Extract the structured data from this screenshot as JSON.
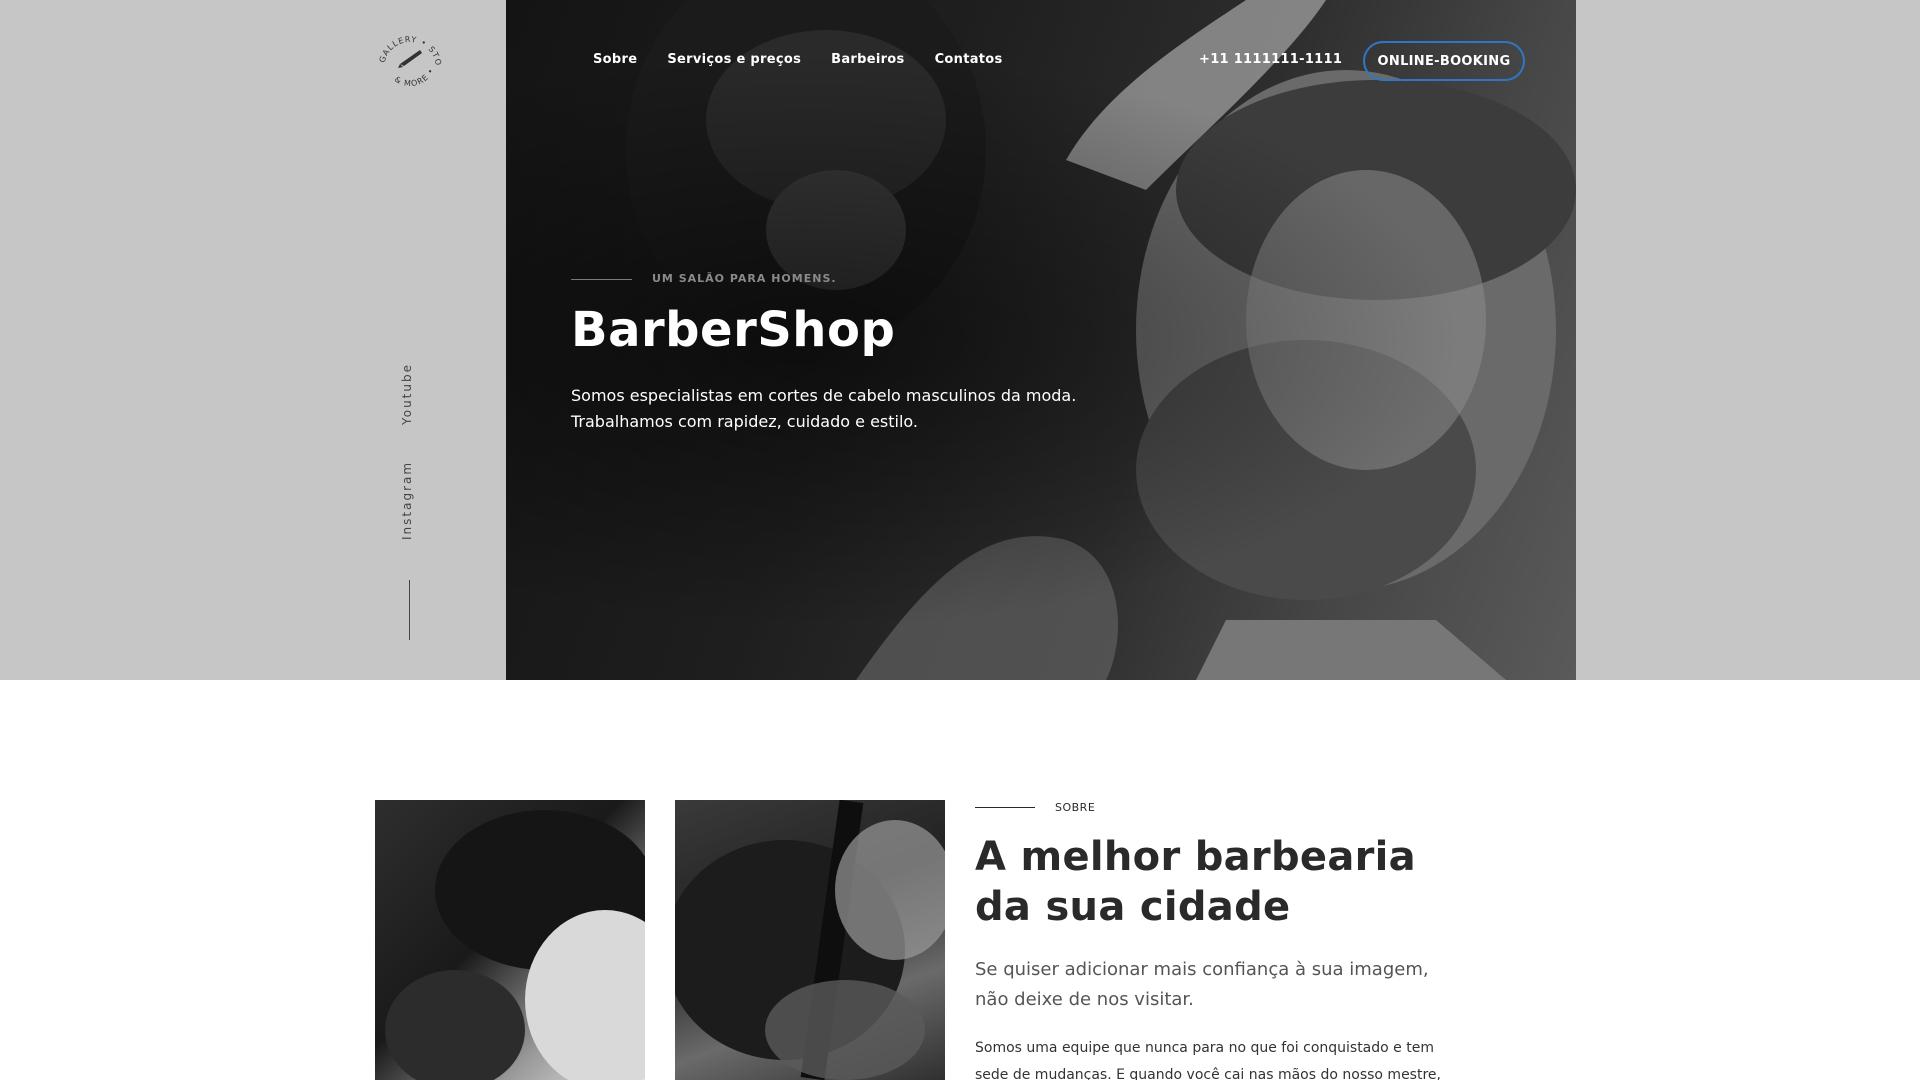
{
  "brand": {
    "logo_text_top": "GALLERY • STORE",
    "logo_text_bottom": "& MORE •"
  },
  "nav": {
    "items": [
      {
        "label": "Sobre"
      },
      {
        "label": "Serviços e preços"
      },
      {
        "label": "Barbeiros"
      },
      {
        "label": "Contatos"
      }
    ],
    "phone": "+11 1111111-1111",
    "booking_label": "ONLINE-BOOKING",
    "booking_border_color": "#2f77c6"
  },
  "hero": {
    "eyebrow": "UM SALÃO PARA HOMENS.",
    "title": "BarberShop",
    "description_line1": "Somos especialistas em cortes de cabelo masculinos da moda.",
    "description_line2": "Trabalhamos com rapidez, cuidado e estilo.",
    "photo_subject": "barber-trimming-beard-photo"
  },
  "social": {
    "youtube": "Youtube",
    "instagram": "Instagram"
  },
  "gallery": {
    "images": [
      {
        "subject": "beard-trim-photo"
      },
      {
        "subject": "haircut-razor-photo"
      }
    ]
  },
  "about": {
    "eyebrow": "SOBRE",
    "title_line1": "A melhor barbearia",
    "title_line2": "da sua cidade",
    "subtitle_line1": "Se quiser adicionar mais confiança à sua imagem,",
    "subtitle_line2": "não deixe de nos visitar.",
    "body_line1": "Somos uma equipe que nunca para no que foi conquistado e tem",
    "body_line2": "sede de mudanças. E quando você cai nas mãos do nosso mestre,"
  },
  "colors": {
    "top_band": "#c6c6c6",
    "accent_blue": "#2f77c6",
    "text_dark": "#2a2a2a"
  }
}
